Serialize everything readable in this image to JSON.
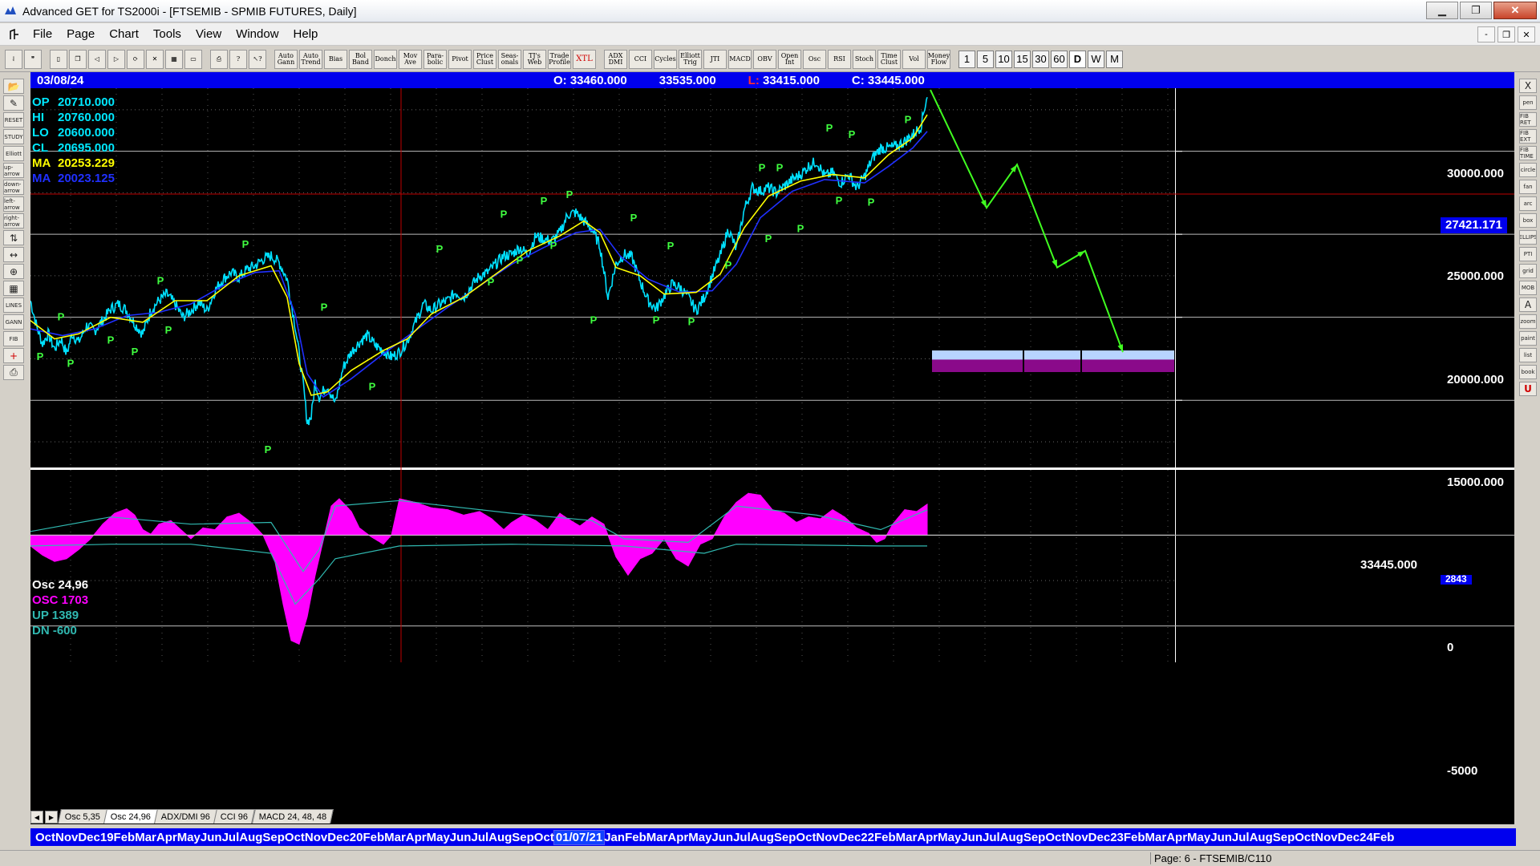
{
  "window": {
    "title": "Advanced GET for TS2000i - [FTSEMIB - SPMIB FUTURES, Daily]",
    "minimize": "▁",
    "maximize": "❐",
    "close": "✕"
  },
  "menu": {
    "items": [
      "File",
      "Page",
      "Chart",
      "Tools",
      "View",
      "Window",
      "Help"
    ],
    "mdi": [
      "-",
      "❐",
      "✕"
    ]
  },
  "toolbar": {
    "study_buttons": [
      "Auto Gann",
      "Auto Trend",
      "Bias",
      "Bol Band",
      "Donch",
      "Mov Ave",
      "Para-bolic",
      "Pivot",
      "Price Clust",
      "Seas-onals",
      "TJ's Web",
      "Trade Profile",
      "XTL",
      "ADX DMI",
      "CCI",
      "Cycles",
      "Elliott Trig",
      "JTI",
      "MACD",
      "OBV",
      "Open Int",
      "Osc",
      "RSI",
      "Stoch",
      "Time Clust",
      "Vol",
      "Money Flow"
    ],
    "periods": [
      "1",
      "5",
      "10",
      "15",
      "30",
      "60",
      "D",
      "W",
      "M"
    ],
    "active_period": "D"
  },
  "lefttools": [
    "open-icon",
    "draw-icon",
    "RESET",
    "STUDY",
    "Elliott",
    "up-arrow",
    "down-arrow",
    "left-arrow",
    "right-arrow",
    "bar-icon",
    "scale-icon",
    "zoom-icon",
    "grid-icon",
    "LINES",
    "GANN",
    "FIB",
    "cross-icon",
    "print-icon"
  ],
  "righttools": [
    "X",
    "pen",
    "FIB RET",
    "FIB EXT",
    "FIB TIME",
    "circle",
    "fan",
    "arc",
    "box",
    "ELLIPS",
    "PTI",
    "grid",
    "MOB",
    "A",
    "zoom",
    "paint",
    "list",
    "book",
    "U"
  ],
  "infobar": {
    "date": "03/08/24",
    "open": "O: 33460.000",
    "high": "33535.000",
    "low_label": "L:",
    "low": "33415.000",
    "close": "C: 33445.000"
  },
  "legend": {
    "op": {
      "key": "OP",
      "value": "20710.000"
    },
    "hi": {
      "key": "HI",
      "value": "20760.000"
    },
    "lo": {
      "key": "LO",
      "value": "20600.000"
    },
    "cl": {
      "key": "CL",
      "value": "20695.000"
    },
    "ma1": {
      "key": "MA",
      "value": "20253.229"
    },
    "ma2": {
      "key": "MA",
      "value": "20023.125"
    }
  },
  "osc_legend": {
    "title": "Osc 24,96",
    "osc": "OSC 1703",
    "up": "UP    1389",
    "dn": "DN    -600"
  },
  "price_axis": {
    "labels": [
      "30000.000",
      "25000.000",
      "20000.000",
      "15000.000"
    ],
    "marker": "27421.171",
    "last": "33445.000"
  },
  "osc_axis": {
    "labels": [
      "2843",
      "0",
      "-5000"
    ]
  },
  "tabs": [
    "Osc 5,35",
    "Osc 24,96",
    "ADX/DMI 96",
    "CCI 96",
    "MACD 24, 48, 48"
  ],
  "active_tab": "Osc 24,96",
  "timeaxis": {
    "before": "OctNovDec19FebMarAprMayJunJulAugSepOctNovDec20FebMarAprMayJunJulAugSepOct",
    "highlight": "01/07/21",
    "after": "JanFebMarAprMayJunJulAugSepOctNovDec22FebMarAprMayJunJulAugSepOctNovDec23FebMarAprMayJunJulAugSepOctNovDec24Feb"
  },
  "statusbar": {
    "page": "Page: 6 - FTSEMIB/C110"
  },
  "colors": {
    "price": "#00e0ff",
    "ma_fast": "#ffff00",
    "ma_slow": "#2030ff",
    "pivot": "#40ff40",
    "projection": "#40ff20",
    "osc": "#ff00ff",
    "osc_band": "#30b8b0",
    "marker_line": "#c00000"
  },
  "chart_data": {
    "type": "line",
    "title": "FTSEMIB - SPMIB FUTURES, Daily",
    "ylim": [
      11000,
      33800
    ],
    "price_path": [
      [
        0,
        21000
      ],
      [
        8,
        19400
      ],
      [
        15,
        18400
      ],
      [
        22,
        19000
      ],
      [
        30,
        18100
      ],
      [
        38,
        18700
      ],
      [
        45,
        17800
      ],
      [
        52,
        19000
      ],
      [
        60,
        18500
      ],
      [
        70,
        19500
      ],
      [
        80,
        19200
      ],
      [
        90,
        19800
      ],
      [
        100,
        20500
      ],
      [
        110,
        20800
      ],
      [
        120,
        20400
      ],
      [
        130,
        19600
      ],
      [
        140,
        19000
      ],
      [
        150,
        20400
      ],
      [
        160,
        21000
      ],
      [
        170,
        21400
      ],
      [
        180,
        20800
      ],
      [
        190,
        20000
      ],
      [
        200,
        20400
      ],
      [
        210,
        20900
      ],
      [
        220,
        20400
      ],
      [
        230,
        21600
      ],
      [
        240,
        22300
      ],
      [
        250,
        22700
      ],
      [
        260,
        22400
      ],
      [
        270,
        22900
      ],
      [
        280,
        23100
      ],
      [
        290,
        23500
      ],
      [
        300,
        23700
      ],
      [
        310,
        23300
      ],
      [
        320,
        22300
      ],
      [
        330,
        19500
      ],
      [
        340,
        16000
      ],
      [
        345,
        13700
      ],
      [
        350,
        14000
      ],
      [
        355,
        16100
      ],
      [
        360,
        15200
      ],
      [
        370,
        15900
      ],
      [
        380,
        14800
      ],
      [
        390,
        17000
      ],
      [
        400,
        17900
      ],
      [
        410,
        18500
      ],
      [
        420,
        18900
      ],
      [
        430,
        18300
      ],
      [
        440,
        18000
      ],
      [
        450,
        17600
      ],
      [
        460,
        17900
      ],
      [
        470,
        18600
      ],
      [
        480,
        19700
      ],
      [
        490,
        20800
      ],
      [
        500,
        20400
      ],
      [
        510,
        20800
      ],
      [
        520,
        21000
      ],
      [
        530,
        21500
      ],
      [
        540,
        21200
      ],
      [
        550,
        21900
      ],
      [
        560,
        22500
      ],
      [
        570,
        22700
      ],
      [
        580,
        23200
      ],
      [
        590,
        23700
      ],
      [
        600,
        23800
      ],
      [
        610,
        24200
      ],
      [
        620,
        23800
      ],
      [
        630,
        24900
      ],
      [
        640,
        24700
      ],
      [
        650,
        24600
      ],
      [
        660,
        25100
      ],
      [
        670,
        26200
      ],
      [
        680,
        26300
      ],
      [
        690,
        25800
      ],
      [
        700,
        25300
      ],
      [
        710,
        24300
      ],
      [
        720,
        21200
      ],
      [
        730,
        23200
      ],
      [
        740,
        23800
      ],
      [
        750,
        23600
      ],
      [
        760,
        22200
      ],
      [
        770,
        21000
      ],
      [
        780,
        20500
      ],
      [
        790,
        21300
      ],
      [
        800,
        22000
      ],
      [
        810,
        21800
      ],
      [
        820,
        21200
      ],
      [
        830,
        20400
      ],
      [
        840,
        21200
      ],
      [
        850,
        22500
      ],
      [
        860,
        23700
      ],
      [
        870,
        25300
      ],
      [
        880,
        24100
      ],
      [
        890,
        26500
      ],
      [
        900,
        27800
      ],
      [
        910,
        27600
      ],
      [
        920,
        27800
      ],
      [
        930,
        27500
      ],
      [
        940,
        27900
      ],
      [
        950,
        28300
      ],
      [
        960,
        28600
      ],
      [
        970,
        29100
      ],
      [
        980,
        29400
      ],
      [
        990,
        28500
      ],
      [
        1000,
        28700
      ],
      [
        1010,
        28100
      ],
      [
        1020,
        28600
      ],
      [
        1030,
        27800
      ],
      [
        1040,
        28500
      ],
      [
        1050,
        29600
      ],
      [
        1060,
        30200
      ],
      [
        1070,
        30200
      ],
      [
        1080,
        30300
      ],
      [
        1090,
        30600
      ],
      [
        1100,
        31000
      ],
      [
        1110,
        31500
      ],
      [
        1118,
        33400
      ]
    ],
    "ma_fast_path": [
      [
        0,
        19800
      ],
      [
        30,
        18700
      ],
      [
        60,
        19000
      ],
      [
        100,
        20000
      ],
      [
        140,
        19700
      ],
      [
        180,
        21000
      ],
      [
        220,
        21000
      ],
      [
        260,
        22500
      ],
      [
        300,
        23100
      ],
      [
        320,
        21200
      ],
      [
        335,
        17200
      ],
      [
        350,
        15300
      ],
      [
        370,
        15500
      ],
      [
        400,
        16800
      ],
      [
        440,
        18000
      ],
      [
        470,
        18700
      ],
      [
        500,
        20200
      ],
      [
        540,
        21200
      ],
      [
        580,
        22600
      ],
      [
        620,
        24000
      ],
      [
        660,
        24900
      ],
      [
        690,
        25800
      ],
      [
        710,
        25100
      ],
      [
        730,
        23000
      ],
      [
        760,
        22500
      ],
      [
        790,
        21400
      ],
      [
        830,
        21500
      ],
      [
        860,
        22600
      ],
      [
        890,
        25400
      ],
      [
        920,
        27300
      ],
      [
        960,
        28200
      ],
      [
        1000,
        28600
      ],
      [
        1040,
        28400
      ],
      [
        1070,
        29800
      ],
      [
        1100,
        30800
      ],
      [
        1118,
        32200
      ]
    ],
    "ma_slow_path": [
      [
        0,
        19300
      ],
      [
        40,
        18900
      ],
      [
        80,
        19300
      ],
      [
        120,
        20100
      ],
      [
        160,
        20300
      ],
      [
        200,
        20800
      ],
      [
        240,
        21900
      ],
      [
        280,
        22700
      ],
      [
        310,
        22800
      ],
      [
        330,
        20200
      ],
      [
        345,
        16600
      ],
      [
        365,
        15200
      ],
      [
        400,
        16300
      ],
      [
        440,
        17800
      ],
      [
        480,
        19200
      ],
      [
        520,
        20600
      ],
      [
        560,
        21900
      ],
      [
        600,
        23200
      ],
      [
        640,
        24200
      ],
      [
        680,
        25100
      ],
      [
        710,
        25300
      ],
      [
        735,
        23700
      ],
      [
        770,
        22300
      ],
      [
        810,
        21500
      ],
      [
        850,
        21600
      ],
      [
        880,
        23200
      ],
      [
        910,
        26000
      ],
      [
        950,
        27600
      ],
      [
        990,
        28300
      ],
      [
        1040,
        28100
      ],
      [
        1070,
        29100
      ],
      [
        1100,
        30200
      ],
      [
        1118,
        31200
      ]
    ],
    "pivots": [
      [
        12,
        18000,
        "low"
      ],
      [
        38,
        20400,
        "low"
      ],
      [
        50,
        17600,
        "low"
      ],
      [
        100,
        19000,
        "low"
      ],
      [
        130,
        18300,
        "low"
      ],
      [
        162,
        21800,
        "high"
      ],
      [
        172,
        19600,
        "low"
      ],
      [
        268,
        24000,
        "high"
      ],
      [
        296,
        12400,
        "low"
      ],
      [
        366,
        20200,
        "high"
      ],
      [
        426,
        16200,
        "low"
      ],
      [
        510,
        23700,
        "high"
      ],
      [
        574,
        22500,
        "low"
      ],
      [
        590,
        25800,
        "high"
      ],
      [
        610,
        23800,
        "low"
      ],
      [
        640,
        26600,
        "high"
      ],
      [
        652,
        24700,
        "low"
      ],
      [
        672,
        27000,
        "high"
      ],
      [
        702,
        20200,
        "low"
      ],
      [
        752,
        25600,
        "high"
      ],
      [
        780,
        20200,
        "low"
      ],
      [
        798,
        23900,
        "high"
      ],
      [
        824,
        20100,
        "low"
      ],
      [
        870,
        23500,
        "low"
      ],
      [
        912,
        28600,
        "high"
      ],
      [
        920,
        25100,
        "low"
      ],
      [
        934,
        28600,
        "high"
      ],
      [
        960,
        25700,
        "low"
      ],
      [
        996,
        31000,
        "high"
      ],
      [
        1008,
        27400,
        "low"
      ],
      [
        1024,
        30600,
        "high"
      ],
      [
        1048,
        27300,
        "low"
      ],
      [
        1094,
        31500,
        "high"
      ]
    ],
    "projection": [
      [
        1122,
        33700
      ],
      [
        1192,
        26600
      ],
      [
        1230,
        29200
      ],
      [
        1280,
        23000
      ],
      [
        1315,
        24000
      ],
      [
        1362,
        17900
      ]
    ],
    "target_zones": [
      {
        "x0": 1124,
        "x1": 1426,
        "y_top": 18000,
        "y_bot": 17450,
        "color": "#b8d4ff"
      },
      {
        "x0": 1124,
        "x1": 1426,
        "y_top": 17450,
        "y_bot": 16700,
        "color": "#8a0a8a"
      }
    ],
    "marker_price": 27421.171,
    "marker_x": 462,
    "osc_ylim": [
      -7000,
      3500
    ],
    "osc_path": [
      [
        0,
        -600
      ],
      [
        15,
        -1100
      ],
      [
        30,
        -1450
      ],
      [
        45,
        -1300
      ],
      [
        60,
        -800
      ],
      [
        75,
        -200
      ],
      [
        90,
        600
      ],
      [
        105,
        1200
      ],
      [
        120,
        1450
      ],
      [
        130,
        1100
      ],
      [
        140,
        300
      ],
      [
        150,
        50
      ],
      [
        160,
        600
      ],
      [
        175,
        800
      ],
      [
        190,
        200
      ],
      [
        200,
        -200
      ],
      [
        215,
        400
      ],
      [
        230,
        300
      ],
      [
        245,
        1000
      ],
      [
        260,
        1200
      ],
      [
        275,
        700
      ],
      [
        290,
        0
      ],
      [
        305,
        -1500
      ],
      [
        315,
        -3800
      ],
      [
        325,
        -5800
      ],
      [
        335,
        -6000
      ],
      [
        345,
        -4500
      ],
      [
        355,
        -2200
      ],
      [
        365,
        -300
      ],
      [
        375,
        1600
      ],
      [
        385,
        2000
      ],
      [
        400,
        1300
      ],
      [
        410,
        400
      ],
      [
        425,
        -100
      ],
      [
        440,
        -500
      ],
      [
        450,
        0
      ],
      [
        460,
        2000
      ],
      [
        470,
        1900
      ],
      [
        480,
        1800
      ],
      [
        500,
        1500
      ],
      [
        520,
        1400
      ],
      [
        540,
        1100
      ],
      [
        560,
        1300
      ],
      [
        575,
        900
      ],
      [
        590,
        300
      ],
      [
        600,
        700
      ],
      [
        615,
        1100
      ],
      [
        630,
        800
      ],
      [
        645,
        300
      ],
      [
        660,
        1200
      ],
      [
        670,
        900
      ],
      [
        685,
        500
      ],
      [
        700,
        1000
      ],
      [
        715,
        600
      ],
      [
        730,
        -1200
      ],
      [
        745,
        -2200
      ],
      [
        760,
        -1300
      ],
      [
        775,
        -1000
      ],
      [
        790,
        -200
      ],
      [
        805,
        -1300
      ],
      [
        820,
        -1700
      ],
      [
        835,
        -500
      ],
      [
        850,
        -200
      ],
      [
        865,
        1000
      ],
      [
        880,
        1800
      ],
      [
        895,
        2300
      ],
      [
        910,
        2200
      ],
      [
        925,
        1400
      ],
      [
        940,
        1200
      ],
      [
        955,
        700
      ],
      [
        970,
        1000
      ],
      [
        985,
        900
      ],
      [
        1000,
        1400
      ],
      [
        1015,
        1000
      ],
      [
        1030,
        400
      ],
      [
        1045,
        100
      ],
      [
        1055,
        -400
      ],
      [
        1065,
        -200
      ],
      [
        1075,
        600
      ],
      [
        1090,
        1400
      ],
      [
        1105,
        1300
      ],
      [
        1118,
        1700
      ]
    ],
    "osc_up_band": [
      [
        0,
        200
      ],
      [
        100,
        1000
      ],
      [
        200,
        600
      ],
      [
        300,
        700
      ],
      [
        340,
        -2000
      ],
      [
        360,
        -800
      ],
      [
        380,
        1600
      ],
      [
        460,
        1900
      ],
      [
        600,
        1200
      ],
      [
        700,
        800
      ],
      [
        740,
        -200
      ],
      [
        820,
        -400
      ],
      [
        880,
        1600
      ],
      [
        980,
        1100
      ],
      [
        1060,
        300
      ],
      [
        1118,
        1389
      ]
    ],
    "osc_dn_band": [
      [
        0,
        -600
      ],
      [
        100,
        -500
      ],
      [
        200,
        -500
      ],
      [
        300,
        -1000
      ],
      [
        330,
        -3800
      ],
      [
        360,
        -2400
      ],
      [
        380,
        -1300
      ],
      [
        460,
        -600
      ],
      [
        600,
        -500
      ],
      [
        740,
        -600
      ],
      [
        840,
        -1000
      ],
      [
        880,
        -500
      ],
      [
        1060,
        -600
      ],
      [
        1118,
        -600
      ]
    ]
  }
}
